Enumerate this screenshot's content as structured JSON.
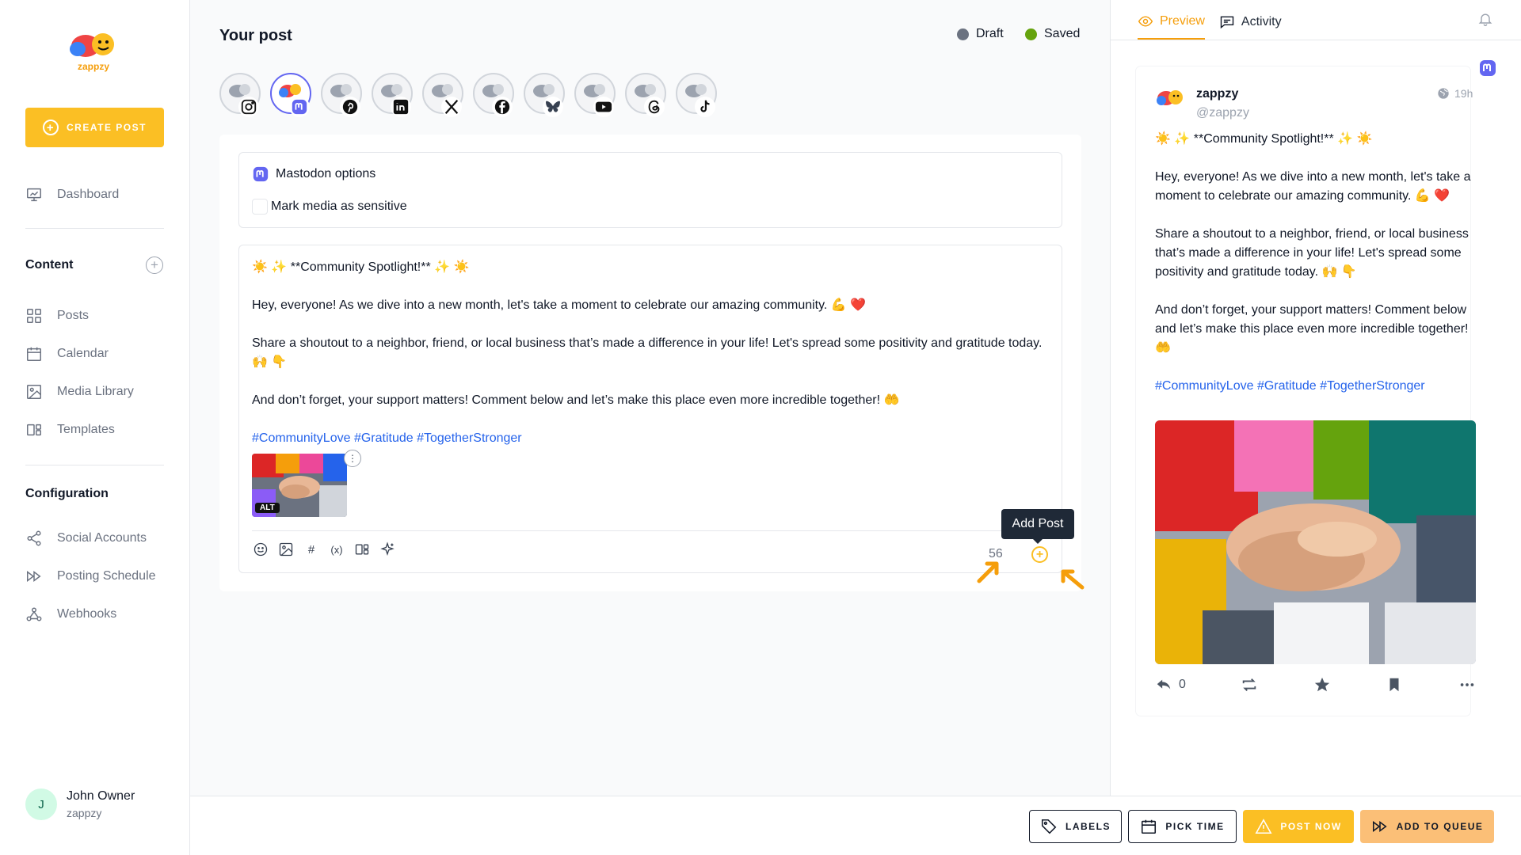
{
  "sidebar": {
    "logo_text": "zappzy",
    "create_label": "CREATE POST",
    "dashboard": "Dashboard",
    "content_title": "Content",
    "content_items": [
      {
        "label": "Posts",
        "icon": "grid-icon"
      },
      {
        "label": "Calendar",
        "icon": "calendar-icon"
      },
      {
        "label": "Media Library",
        "icon": "image-icon"
      },
      {
        "label": "Templates",
        "icon": "templates-icon"
      }
    ],
    "config_title": "Configuration",
    "config_items": [
      {
        "label": "Social Accounts",
        "icon": "share-icon"
      },
      {
        "label": "Posting Schedule",
        "icon": "forward-icon"
      },
      {
        "label": "Webhooks",
        "icon": "webhook-icon"
      }
    ],
    "user": {
      "initial": "J",
      "name": "John Owner",
      "org": "zappzy"
    }
  },
  "main": {
    "title": "Your post",
    "status": [
      {
        "label": "Draft",
        "color": "#6b7280"
      },
      {
        "label": "Saved",
        "color": "#65a30d"
      }
    ],
    "accounts": [
      {
        "network": "instagram-icon",
        "active": false
      },
      {
        "network": "mastodon-icon",
        "active": true
      },
      {
        "network": "pinterest-icon",
        "active": false
      },
      {
        "network": "linkedin-icon",
        "active": false
      },
      {
        "network": "x-icon",
        "active": false
      },
      {
        "network": "facebook-icon",
        "active": false
      },
      {
        "network": "bluesky-icon",
        "active": false
      },
      {
        "network": "youtube-icon",
        "active": false
      },
      {
        "network": "threads-icon",
        "active": false
      },
      {
        "network": "tiktok-icon",
        "active": false
      }
    ],
    "options_title": "Mastodon options",
    "sensitive_label": "Mark media as sensitive",
    "post": {
      "line1": "☀️ ✨ **Community Spotlight!** ✨ ☀️",
      "line2": "Hey, everyone! As we dive into a new month, let's take a moment to celebrate our amazing community. 💪 ❤️",
      "line3": "Share a shoutout to a neighbor, friend, or local business that’s made a difference in your life! Let's spread some positivity and gratitude today. 🙌 👇",
      "line4": "And don’t forget, your support matters! Comment below and let’s make this place even more incredible together! 🤲",
      "tags": "#CommunityLove #Gratitude #TogetherStronger"
    },
    "alt_label": "ALT",
    "toolbar": [
      "emoji-icon",
      "image-icon",
      "hashtag-icon",
      "variable-icon",
      "templates-icon",
      "sparkle-icon"
    ],
    "hashtag_glyph": "#",
    "variable_glyph": "(x)",
    "char_count": "56",
    "tooltip": "Add Post",
    "accent": "#fbbf24"
  },
  "preview": {
    "tab_preview": "Preview",
    "tab_activity": "Activity",
    "name": "zappzy",
    "handle": "@zappzy",
    "time": "19h",
    "replies": "0"
  },
  "bottom": {
    "labels": "LABELS",
    "pick_time": "PICK TIME",
    "post_now": "POST NOW",
    "add_queue": "ADD TO QUEUE"
  }
}
